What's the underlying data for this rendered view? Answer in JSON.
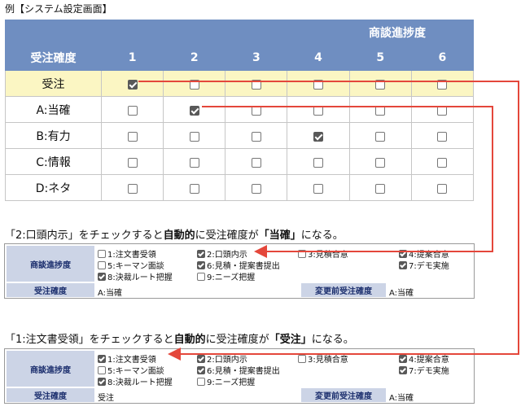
{
  "title": "例【システム設定画面】",
  "matrix": {
    "group_header": "商談進捗度",
    "row_header": "受注確度",
    "columns": [
      "1",
      "2",
      "3",
      "4",
      "5",
      "6"
    ],
    "rows": [
      {
        "label": "受注",
        "checks": [
          true,
          false,
          false,
          false,
          false,
          false
        ]
      },
      {
        "label": "A:当確",
        "checks": [
          false,
          true,
          false,
          false,
          false,
          false
        ]
      },
      {
        "label": "B:有力",
        "checks": [
          false,
          false,
          false,
          true,
          false,
          false
        ]
      },
      {
        "label": "C:情報",
        "checks": [
          false,
          false,
          false,
          false,
          false,
          false
        ]
      },
      {
        "label": "D:ネタ",
        "checks": [
          false,
          false,
          false,
          false,
          false,
          false
        ]
      }
    ]
  },
  "caption1": {
    "pre": "「2:口頭内示」をチェックすると",
    "bold1": "自動的",
    "mid": "に受注確度が",
    "bold2": "「当確」",
    "post": "になる。"
  },
  "caption2": {
    "pre": "「1:注文書受領」をチェックすると",
    "bold1": "自動的",
    "mid": "に受注確度が",
    "bold2": "「受注」",
    "post": "になる。"
  },
  "panel1": {
    "progress_label": "商談進捗度",
    "options": [
      {
        "text": "1:注文書受領",
        "checked": false
      },
      {
        "text": "2:口頭内示",
        "checked": true
      },
      {
        "text": "3:見積合意",
        "checked": false
      },
      {
        "text": "4:提案合意",
        "checked": true
      },
      {
        "text": "5:キーマン面談",
        "checked": false
      },
      {
        "text": "6:見積・提案書提出",
        "checked": true
      },
      {
        "text": "7:デモ実施",
        "checked": true
      },
      {
        "text": "8:決裁ルート把握",
        "checked": true
      },
      {
        "text": "9:ニーズ把握",
        "checked": false
      }
    ],
    "accuracy_label": "受注確度",
    "accuracy_value": "A:当確",
    "prev_label": "変更前受注確度",
    "prev_value": "A:当確"
  },
  "panel2": {
    "progress_label": "商談進捗度",
    "options": [
      {
        "text": "1:注文書受領",
        "checked": true
      },
      {
        "text": "2:口頭内示",
        "checked": true
      },
      {
        "text": "3:見積合意",
        "checked": false
      },
      {
        "text": "4:提案合意",
        "checked": true
      },
      {
        "text": "5:キーマン面談",
        "checked": false
      },
      {
        "text": "6:見積・提案書提出",
        "checked": true
      },
      {
        "text": "7:デモ実施",
        "checked": true
      },
      {
        "text": "8:決裁ルート把握",
        "checked": true
      },
      {
        "text": "9:ニーズ把握",
        "checked": false
      }
    ],
    "accuracy_label": "受注確度",
    "accuracy_value": "受注",
    "prev_label": "変更前受注確度",
    "prev_value": "A:当確"
  },
  "colors": {
    "header": "#6f8ec1",
    "highlight": "#fbf6c3",
    "label_bg": "#ccd4e6",
    "arrow": "#e4473b"
  }
}
